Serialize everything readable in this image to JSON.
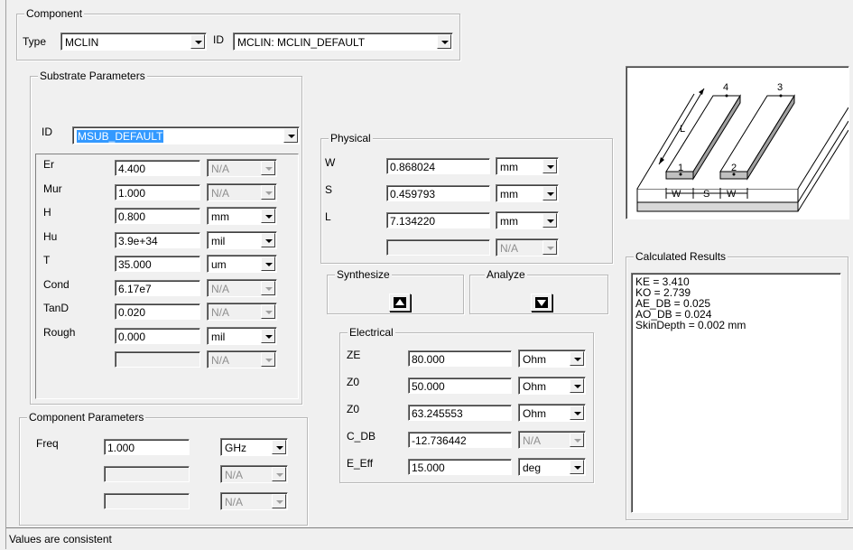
{
  "component": {
    "legend": "Component",
    "type_label": "Type",
    "type_value": "MCLIN",
    "id_label": "ID",
    "id_value": "MCLIN: MCLIN_DEFAULT"
  },
  "substrate": {
    "legend": "Substrate Parameters",
    "id_label": "ID",
    "id_value": "MSUB_DEFAULT",
    "params": [
      {
        "label": "Er",
        "value": "4.400",
        "unit": "N/A",
        "unit_disabled": true
      },
      {
        "label": "Mur",
        "value": "1.000",
        "unit": "N/A",
        "unit_disabled": true
      },
      {
        "label": "H",
        "value": "0.800",
        "unit": "mm",
        "unit_disabled": false
      },
      {
        "label": "Hu",
        "value": "3.9e+34",
        "unit": "mil",
        "unit_disabled": false
      },
      {
        "label": "T",
        "value": "35.000",
        "unit": "um",
        "unit_disabled": false
      },
      {
        "label": "Cond",
        "value": "6.17e7",
        "unit": "N/A",
        "unit_disabled": true
      },
      {
        "label": "TanD",
        "value": "0.020",
        "unit": "N/A",
        "unit_disabled": true
      },
      {
        "label": "Rough",
        "value": "0.000",
        "unit": "mil",
        "unit_disabled": false
      },
      {
        "label": "",
        "value": "",
        "unit": "N/A",
        "unit_disabled": true
      }
    ]
  },
  "component_params": {
    "legend": "Component Parameters",
    "params": [
      {
        "label": "Freq",
        "value": "1.000",
        "unit": "GHz",
        "unit_disabled": false
      },
      {
        "label": "",
        "value": "",
        "unit": "N/A",
        "unit_disabled": true
      },
      {
        "label": "",
        "value": "",
        "unit": "N/A",
        "unit_disabled": true
      }
    ]
  },
  "physical": {
    "legend": "Physical",
    "params": [
      {
        "label": "W",
        "value": "0.868024",
        "unit": "mm",
        "unit_disabled": false
      },
      {
        "label": "S",
        "value": "0.459793",
        "unit": "mm",
        "unit_disabled": false
      },
      {
        "label": "L",
        "value": "7.134220",
        "unit": "mm",
        "unit_disabled": false
      },
      {
        "label": "",
        "value": "",
        "unit": "N/A",
        "unit_disabled": true
      }
    ]
  },
  "synthesize": {
    "legend": "Synthesize"
  },
  "analyze": {
    "legend": "Analyze"
  },
  "electrical": {
    "legend": "Electrical",
    "params": [
      {
        "label": "ZE",
        "value": "80.000",
        "unit": "Ohm",
        "unit_disabled": false
      },
      {
        "label": "Z0",
        "value": "50.000",
        "unit": "Ohm",
        "unit_disabled": false
      },
      {
        "label": "Z0",
        "value": "63.245553",
        "unit": "Ohm",
        "unit_disabled": false
      },
      {
        "label": "C_DB",
        "value": "-12.736442",
        "unit": "N/A",
        "unit_disabled": true
      },
      {
        "label": "E_Eff",
        "value": "15.000",
        "unit": "deg",
        "unit_disabled": false
      }
    ]
  },
  "diagram": {
    "port_labels": [
      "4",
      "3",
      "1",
      "2"
    ],
    "length_label": "L",
    "dimension_text": "W S W"
  },
  "results": {
    "legend": "Calculated Results",
    "lines": [
      "KE = 3.410",
      "KO = 2.739",
      "AE_DB = 0.025",
      "AO_DB = 0.024",
      "SkinDepth = 0.002 mm"
    ]
  },
  "status": {
    "text": "Values are consistent"
  }
}
